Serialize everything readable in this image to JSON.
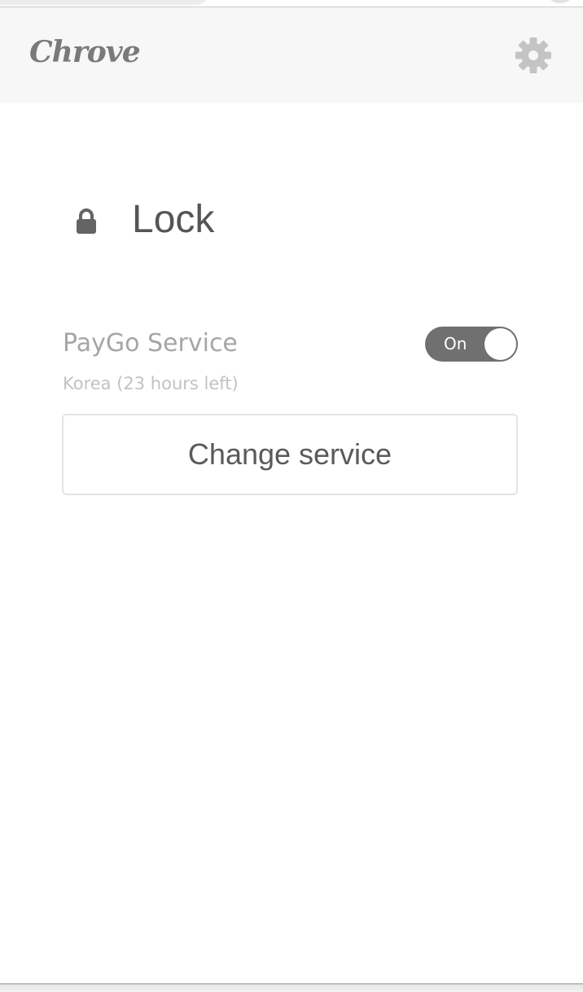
{
  "header": {
    "brand": "Chrove",
    "settings_icon": "gear-icon"
  },
  "main": {
    "lock_icon": "lock-icon",
    "title": "Lock",
    "service": {
      "label": "PayGo Service",
      "detail": "Korea (23 hours left)",
      "toggle_label": "On",
      "enabled": true
    },
    "change_button_label": "Change service"
  },
  "colors": {
    "header_bg": "#f7f7f7",
    "toggle_on": "#707070",
    "icon": "#646464",
    "text_muted": "#a6a6a6"
  }
}
